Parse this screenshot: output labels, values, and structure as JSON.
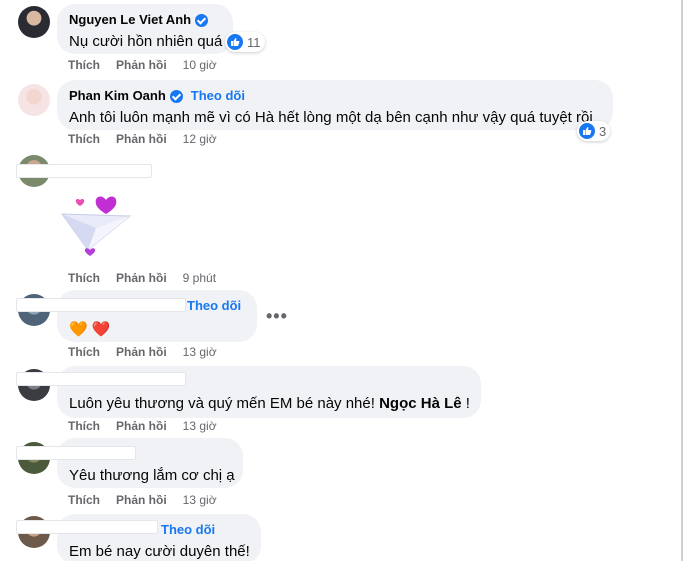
{
  "comments": [
    {
      "name": "Nguyen Le Viet Anh",
      "text": "Nụ cười hồn nhiên quá",
      "reaction_count": "11",
      "actions": {
        "like": "Thích",
        "reply": "Phản hồi",
        "time": "10 giờ"
      }
    },
    {
      "name": "Phan Kim Oanh",
      "follow": "Theo dõi",
      "text": "Anh tôi luôn mạnh mẽ vì có Hà hết lòng một dạ bên cạnh như vậy quá tuyệt rồi",
      "reaction_count": "3",
      "actions": {
        "like": "Thích",
        "reply": "Phản hồi",
        "time": "12 giờ"
      }
    },
    {
      "sticker": "paper-plane-hearts",
      "actions": {
        "like": "Thích",
        "reply": "Phản hồi",
        "time": "9 phút"
      }
    },
    {
      "follow": "Theo dõi",
      "emoji_text": "🧡 ❤️",
      "actions": {
        "like": "Thích",
        "reply": "Phản hồi",
        "time": "13 giờ"
      }
    },
    {
      "text_prefix": "Luôn yêu thương và quý mến EM bé này nhé! ",
      "mention": "Ngọc Hà Lê",
      "text_suffix": " !",
      "actions": {
        "like": "Thích",
        "reply": "Phản hồi",
        "time": "13 giờ"
      }
    },
    {
      "text": "Yêu thương lắm cơ chị ạ",
      "actions": {
        "like": "Thích",
        "reply": "Phản hồi",
        "time": "13 giờ"
      }
    },
    {
      "follow": "Theo dõi",
      "text": "Em bé nay cười duyên thế!"
    }
  ],
  "colors": {
    "bubble": "#f0f2f5",
    "link": "#1877f2",
    "meta": "#65676b"
  }
}
